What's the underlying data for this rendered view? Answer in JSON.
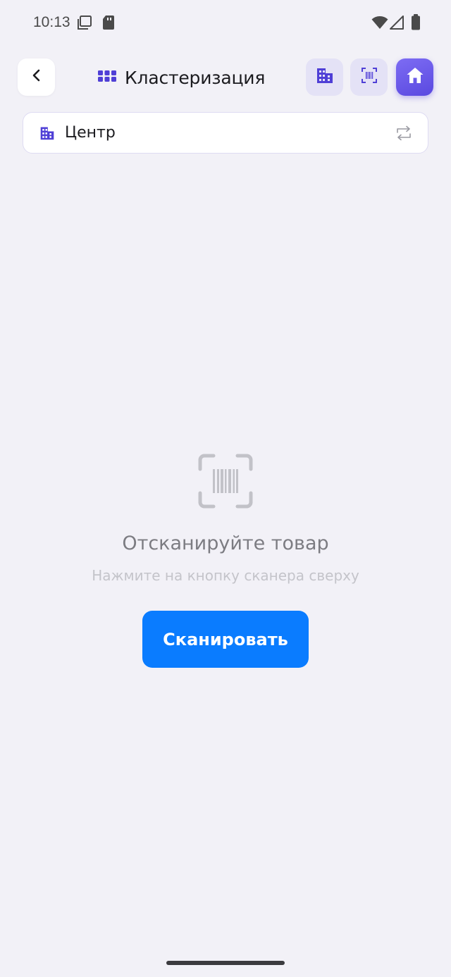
{
  "status_bar": {
    "time": "10:13"
  },
  "header": {
    "title": "Кластеризация"
  },
  "selector": {
    "label": "Центр"
  },
  "empty_state": {
    "title": "Отсканируйте товар",
    "subtitle": "Нажмите на кнопку сканера сверху",
    "button_label": "Сканировать"
  },
  "colors": {
    "background": "#f2f1f7",
    "accent": "#5a49e0",
    "primary_button": "#0a7cff"
  },
  "icons": {
    "back": "chevron-left-icon",
    "title": "grid-icon",
    "warehouse": "building-icon",
    "scanner": "barcode-scan-icon",
    "home": "home-icon",
    "swap": "swap-icon"
  }
}
